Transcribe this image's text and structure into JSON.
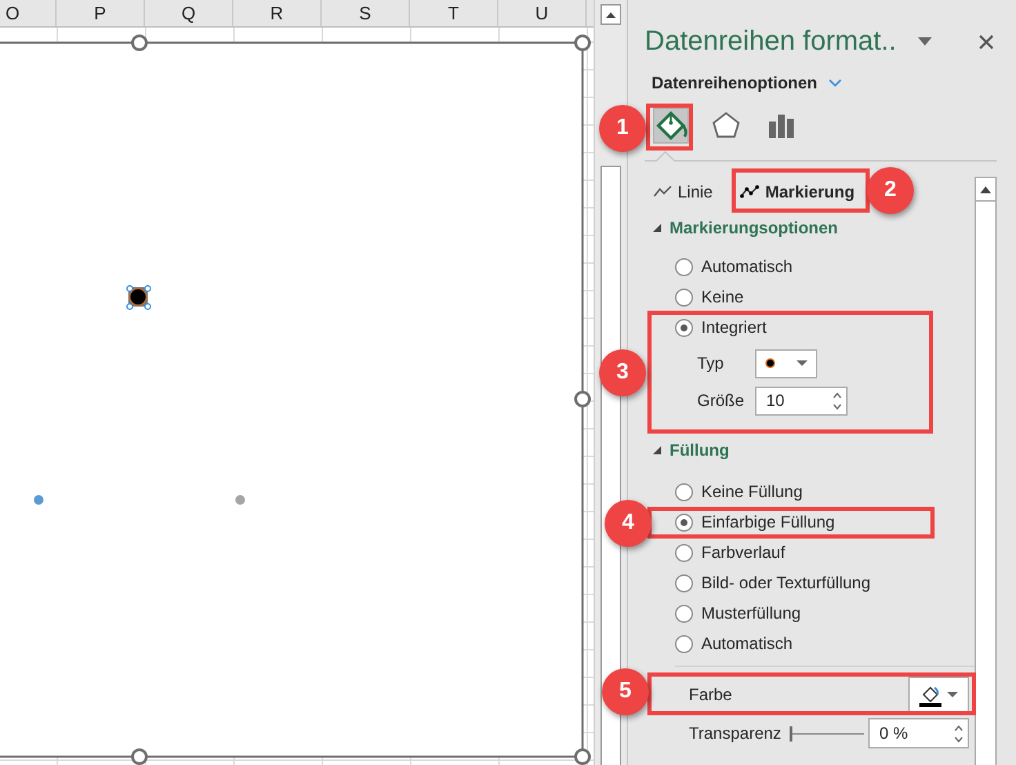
{
  "sheet": {
    "columns": [
      "O",
      "P",
      "Q",
      "R",
      "S",
      "T",
      "U"
    ]
  },
  "pane": {
    "title": "Datenreihen format..",
    "options_menu": "Datenreihenoptionen",
    "category_icons": [
      {
        "kind": "fill",
        "selected": true
      },
      {
        "kind": "effects",
        "selected": false
      },
      {
        "kind": "series",
        "selected": false
      }
    ],
    "tabs": [
      {
        "kind": "line",
        "label": "Linie",
        "selected": false
      },
      {
        "kind": "marker",
        "label": "Markierung",
        "selected": true
      }
    ],
    "sections": [
      {
        "title": "Markierungsoptionen",
        "expanded": true,
        "items": [
          {
            "kind": "radio",
            "label": "Automatisch",
            "selected": false
          },
          {
            "kind": "radio",
            "label": "Keine",
            "selected": false
          },
          {
            "kind": "radio",
            "label": "Integriert",
            "selected": true
          },
          {
            "kind": "dropdown",
            "label": "Typ"
          },
          {
            "kind": "spin",
            "label": "Größe",
            "value": "10"
          }
        ]
      },
      {
        "title": "Füllung",
        "expanded": true,
        "items": [
          {
            "kind": "radio",
            "label": "Keine Füllung",
            "selected": false
          },
          {
            "kind": "radio",
            "label": "Einfarbige Füllung",
            "selected": true
          },
          {
            "kind": "radio",
            "label": "Farbverlauf",
            "selected": false
          },
          {
            "kind": "radio",
            "label": "Bild- oder Texturfüllung",
            "selected": false
          },
          {
            "kind": "radio",
            "label": "Musterfüllung",
            "selected": false
          },
          {
            "kind": "radio",
            "label": "Automatisch",
            "selected": false
          },
          {
            "kind": "color",
            "label": "Farbe"
          },
          {
            "kind": "slider",
            "label": "Transparenz",
            "level": 0,
            "value": "0 %"
          }
        ]
      }
    ]
  },
  "annotations": [
    {
      "number": "1"
    },
    {
      "number": "2"
    },
    {
      "number": "3"
    },
    {
      "number": "4"
    },
    {
      "number": "5"
    }
  ]
}
